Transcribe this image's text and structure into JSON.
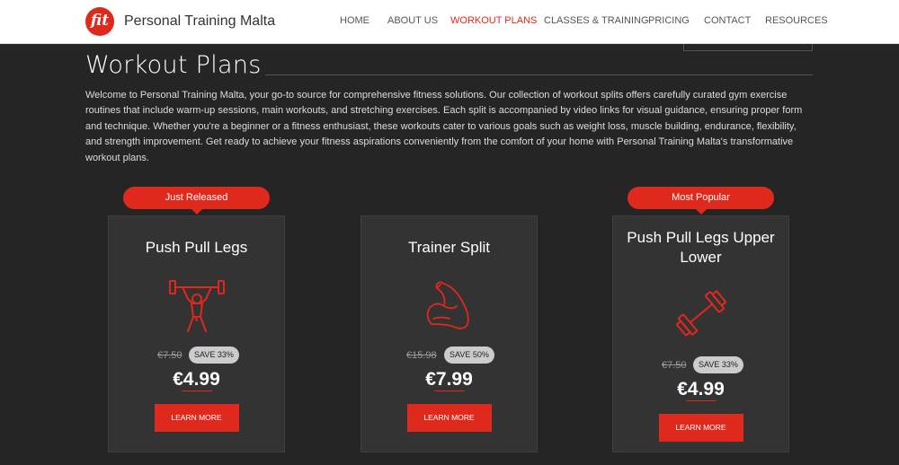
{
  "header": {
    "logo_text": "fit",
    "brand": "Personal Training Malta",
    "nav": [
      {
        "label": "HOME",
        "active": false
      },
      {
        "label": "ABOUT US",
        "active": false
      },
      {
        "label": "WORKOUT PLANS",
        "active": true
      },
      {
        "label": "CLASSES & TRAINING",
        "active": false
      },
      {
        "label": "PRICING",
        "active": false
      },
      {
        "label": "CONTACT",
        "active": false
      },
      {
        "label": "RESOURCES",
        "active": false
      }
    ]
  },
  "main": {
    "title": "Workout Plans",
    "intro": "Welcome to Personal Training Malta, your go-to source for comprehensive fitness solutions. Our collection of workout splits offers carefully curated gym exercise routines that include warm-up sessions, main workouts, and stretching exercises. Each split is accompanied by video links for visual guidance, ensuring proper form and technique. Whether you're a beginner or a fitness enthusiast, these workouts cater to various goals such as weight loss, muscle building, endurance, flexibility, and strength improvement. Get ready to achieve your fitness aspirations conveniently from the comfort of your home with Personal Training Malta's transformative workout plans.",
    "cards": [
      {
        "badge": "Just Released",
        "title": "Push Pull Legs",
        "icon": "weightlifter-icon",
        "old_price": "€7.50",
        "save": "SAVE 33%",
        "price": "€4.99",
        "button": "LEARN MORE"
      },
      {
        "badge": "",
        "title": "Trainer Split",
        "icon": "flexed-bicep-icon",
        "old_price": "€15.98",
        "save": "SAVE 50%",
        "price": "€7.99",
        "button": "LEARN MORE"
      },
      {
        "badge": "Most Popular",
        "title": "Push Pull Legs Upper Lower",
        "icon": "dumbbell-icon",
        "old_price": "€7.50",
        "save": "SAVE 33%",
        "price": "€4.99",
        "button": "LEARN MORE"
      }
    ]
  },
  "colors": {
    "accent": "#e0291d",
    "background": "#252525",
    "card": "#333333"
  }
}
